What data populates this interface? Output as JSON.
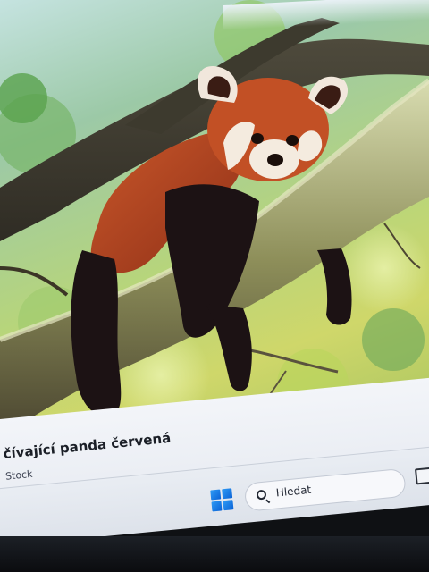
{
  "image": {
    "subject_icon": "red-panda-photo"
  },
  "caption": {
    "title": "čívající panda červená",
    "source": "Stock"
  },
  "taskbar": {
    "start_icon": "windows-start-icon",
    "search_placeholder": "Hledat",
    "search_icon": "search-icon",
    "tray_icon": "tray-app-icon"
  },
  "colors": {
    "panda_fur": "#b5461f",
    "panda_dark_fur": "#1c1214",
    "foliage": "#9ccc6a",
    "start_blue": "#1a78e6"
  }
}
